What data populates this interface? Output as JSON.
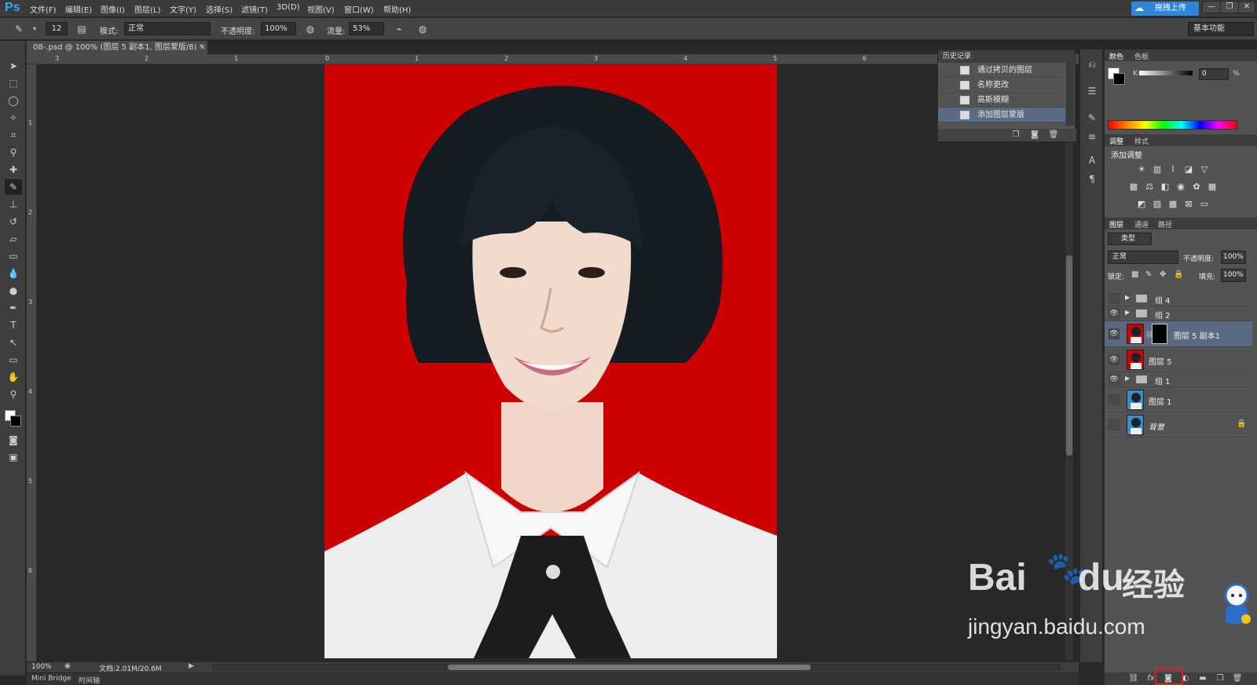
{
  "app": {
    "logo": "Ps",
    "menu": [
      "文件(F)",
      "编辑(E)",
      "图像(I)",
      "图层(L)",
      "文字(Y)",
      "选择(S)",
      "滤镜(T)",
      "3D(D)",
      "视图(V)",
      "窗口(W)",
      "帮助(H)"
    ],
    "cloud_button": "拖拽上传",
    "window_controls": [
      "—",
      "❐",
      "✕"
    ]
  },
  "options_bar": {
    "brush_size": "12",
    "mode_label": "模式:",
    "mode_value": "正常",
    "opacity_label": "不透明度:",
    "opacity_value": "100%",
    "flow_label": "流量:",
    "flow_value": "53%",
    "workspace": "基本功能"
  },
  "document": {
    "tab_title": "08-.psd @ 100% (图层 5 副本1, 图层蒙版/8) *",
    "close": "×",
    "ruler_h": [
      "3",
      "2",
      "1",
      "0",
      "1",
      "2",
      "3",
      "4",
      "5",
      "6"
    ],
    "ruler_v": [
      "1",
      "2",
      "3",
      "4",
      "5",
      "6"
    ]
  },
  "status": {
    "zoom": "100%",
    "doc_info": "文档:2.01M/20.6M"
  },
  "bottom_tabs": [
    "Mini Bridge",
    "时间轴"
  ],
  "history": {
    "title": "历史记录",
    "items": [
      {
        "label": "通过拷贝的图层",
        "active": false
      },
      {
        "label": "名称更改",
        "active": false
      },
      {
        "label": "高斯模糊",
        "active": false
      },
      {
        "label": "添加图层蒙版",
        "active": true
      }
    ]
  },
  "color_panel": {
    "tabs": [
      "颜色",
      "色板"
    ],
    "channel_label": "K",
    "channel_value": "0",
    "unit": "%"
  },
  "adjust_panel": {
    "tabs": [
      "调整",
      "样式"
    ],
    "title": "添加调整"
  },
  "layers_panel": {
    "tabs": [
      "图层",
      "通道",
      "路径"
    ],
    "filter_kind": "类型",
    "blend_mode": "正常",
    "opacity_label": "不透明度:",
    "opacity_value": "100%",
    "lock_label": "锁定:",
    "fill_label": "填充:",
    "fill_value": "100%",
    "layers": [
      {
        "name": "组 4",
        "type": "group",
        "visible": false
      },
      {
        "name": "组 2",
        "type": "group",
        "visible": true
      },
      {
        "name": "图层 5 副本1",
        "type": "layer-mask",
        "visible": true,
        "active": true
      },
      {
        "name": "图层 5",
        "type": "layer",
        "visible": true
      },
      {
        "name": "组 1",
        "type": "group",
        "visible": true
      },
      {
        "name": "图层 1",
        "type": "layer-blue",
        "visible": false
      },
      {
        "name": "背景",
        "type": "background",
        "visible": false
      }
    ]
  },
  "watermark": {
    "brand": "Bai",
    "brand2": "du",
    "cn": "经验",
    "url": "jingyan.baidu.com"
  },
  "colors": {
    "canvas_bg": "#cc0000",
    "accent": "#31a8ff",
    "highlight": "#e02020"
  }
}
